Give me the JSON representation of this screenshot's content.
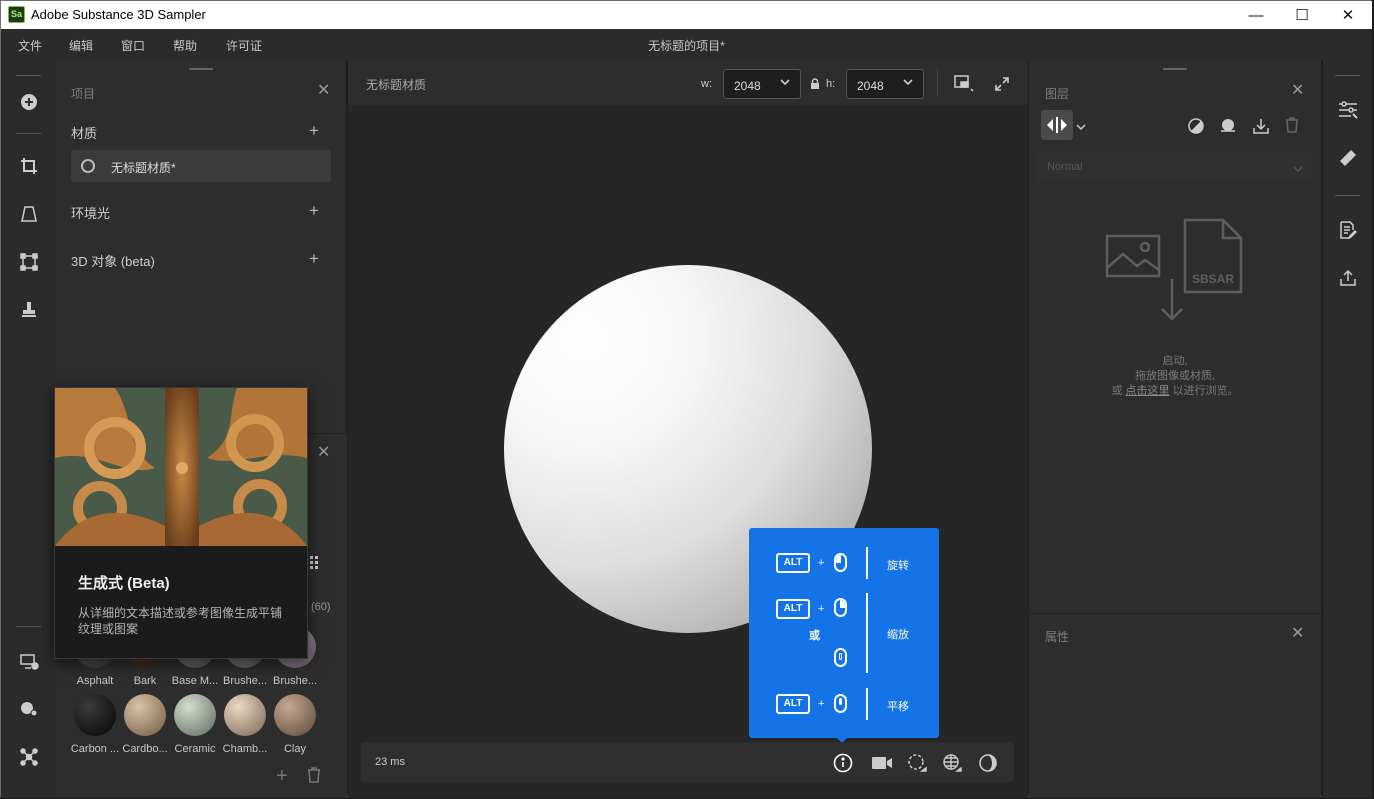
{
  "window": {
    "title": "Adobe Substance 3D Sampler",
    "logo": "Sa",
    "minimize": "—",
    "maximize": "☐",
    "close": "✕"
  },
  "menu": {
    "items": [
      "文件",
      "编辑",
      "窗口",
      "帮助",
      "许可证"
    ],
    "project_title": "无标题的项目*"
  },
  "project_panel": {
    "title": "项目",
    "sections": {
      "materials": "材质",
      "environment": "环境光",
      "objects": "3D 对象 (beta)"
    },
    "material_item": "无标题材质*"
  },
  "library": {
    "count": "(60)",
    "row1": [
      "Asphalt",
      "Bark",
      "Base M...",
      "Brushe...",
      "Brushe..."
    ],
    "row2": [
      "Carbon ...",
      "Cardbo...",
      "Ceramic",
      "Chamb...",
      "Clay"
    ]
  },
  "generative_card": {
    "title": "生成式 (Beta)",
    "description_line1": "从详细的文本描述或参考图像生成平铺",
    "description_line2": "纹理或图案"
  },
  "viewport": {
    "title": "无标题材质",
    "w_label": "w:",
    "h_label": "h:",
    "width_value": "2048",
    "height_value": "2048",
    "render_time": "23 ms"
  },
  "hint": {
    "alt_key": "ALT",
    "plus": "+",
    "or": "或",
    "rotate": "旋转",
    "zoom": "缩放",
    "pan": "平移"
  },
  "layers_panel": {
    "title": "图层",
    "blend_mode": "Normal",
    "sbsar_label": "SBSAR",
    "empty_line1": "启动,",
    "empty_line2": "拖放图像或材质,",
    "empty_line3_prefix": "或",
    "empty_link": "点击这里",
    "empty_line3_suffix": "以进行浏览。"
  },
  "properties_panel": {
    "title": "属性"
  },
  "colors": {
    "accent_blue": "#1473e6",
    "panel_bg": "#2d2d2d",
    "viewport_bg": "#262626"
  }
}
